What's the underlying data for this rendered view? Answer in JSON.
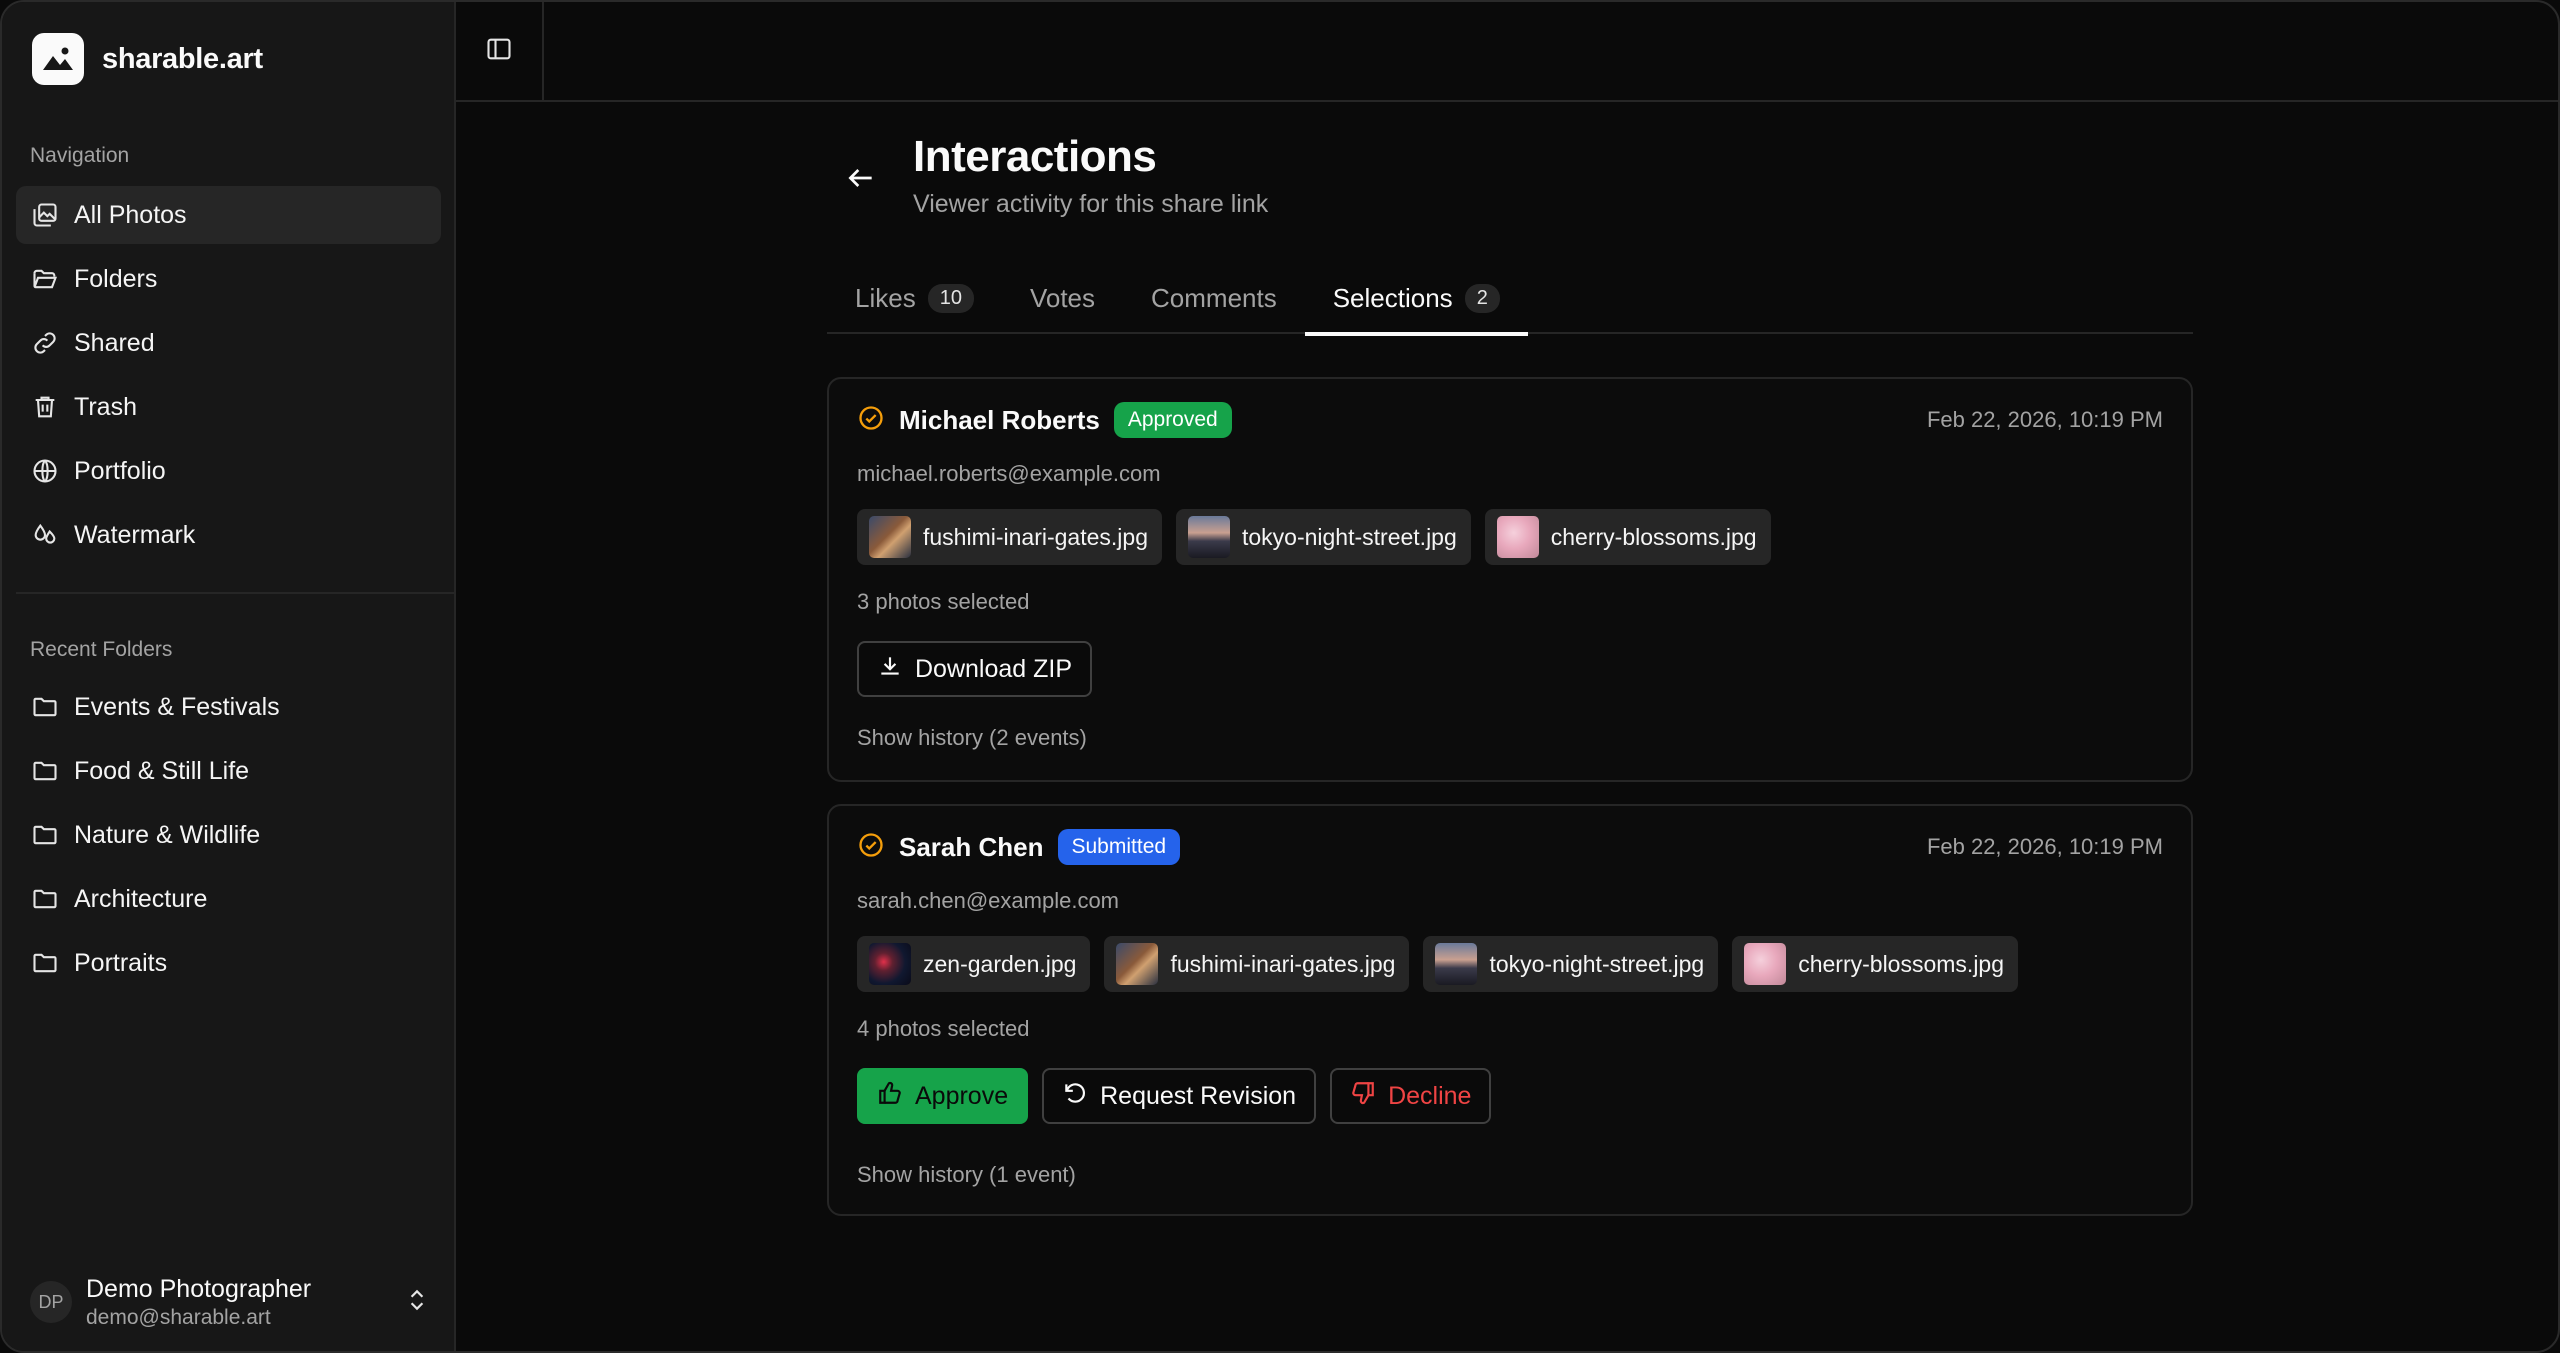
{
  "brand": {
    "name": "sharable.art"
  },
  "sidebar": {
    "navigation_label": "Navigation",
    "nav_items": [
      {
        "label": "All Photos",
        "icon": "photos-icon",
        "active": true
      },
      {
        "label": "Folders",
        "icon": "folder-open-icon"
      },
      {
        "label": "Shared",
        "icon": "link-icon"
      },
      {
        "label": "Trash",
        "icon": "trash-icon"
      },
      {
        "label": "Portfolio",
        "icon": "globe-icon"
      },
      {
        "label": "Watermark",
        "icon": "droplets-icon"
      }
    ],
    "recent_label": "Recent Folders",
    "recent_folders": [
      {
        "label": "Events & Festivals"
      },
      {
        "label": "Food & Still Life"
      },
      {
        "label": "Nature & Wildlife"
      },
      {
        "label": "Architecture"
      },
      {
        "label": "Portraits"
      }
    ],
    "user": {
      "initials": "DP",
      "name": "Demo Photographer",
      "email": "demo@sharable.art"
    }
  },
  "page": {
    "title": "Interactions",
    "subtitle": "Viewer activity for this share link"
  },
  "tabs": [
    {
      "label": "Likes",
      "count": "10"
    },
    {
      "label": "Votes",
      "count": ""
    },
    {
      "label": "Comments",
      "count": ""
    },
    {
      "label": "Selections",
      "count": "2",
      "active": true
    }
  ],
  "selections": [
    {
      "name": "Michael Roberts",
      "status": "Approved",
      "date": "Feb 22, 2026, 10:19 PM",
      "email": "michael.roberts@example.com",
      "photos": [
        "fushimi-inari-gates.jpg",
        "tokyo-night-street.jpg",
        "cherry-blossoms.jpg"
      ],
      "selected_text": "3 photos selected",
      "download_label": "Download ZIP",
      "history": "Show history (2 events)"
    },
    {
      "name": "Sarah Chen",
      "status": "Submitted",
      "date": "Feb 22, 2026, 10:19 PM",
      "email": "sarah.chen@example.com",
      "photos": [
        "zen-garden.jpg",
        "fushimi-inari-gates.jpg",
        "tokyo-night-street.jpg",
        "cherry-blossoms.jpg"
      ],
      "selected_text": "4 photos selected",
      "approve_label": "Approve",
      "revision_label": "Request Revision",
      "decline_label": "Decline",
      "history": "Show history (1 event)"
    }
  ],
  "colors": {
    "approved": "#16a34a",
    "submitted": "#2563eb",
    "decline": "#ef4444",
    "pending_check": "#f59e0b"
  }
}
